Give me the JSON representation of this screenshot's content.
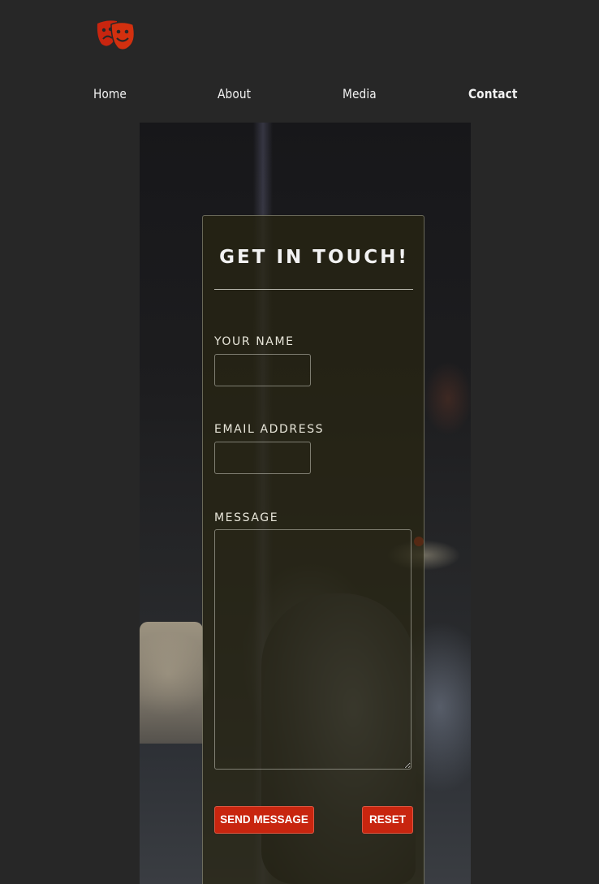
{
  "brand": {
    "logo_icon": "theater-masks-icon",
    "accent_color": "#c8250f"
  },
  "nav": {
    "items": [
      {
        "label": "Home"
      },
      {
        "label": "About"
      },
      {
        "label": "Media"
      },
      {
        "label": "Contact",
        "active": true
      }
    ]
  },
  "contact_form": {
    "title": "GET IN TOUCH!",
    "name_label": "YOUR NAME",
    "name_value": "",
    "email_label": "EMAIL ADDRESS",
    "email_value": "",
    "message_label": "MESSAGE",
    "message_value": "",
    "send_label": "SEND MESSAGE",
    "reset_label": "RESET"
  }
}
